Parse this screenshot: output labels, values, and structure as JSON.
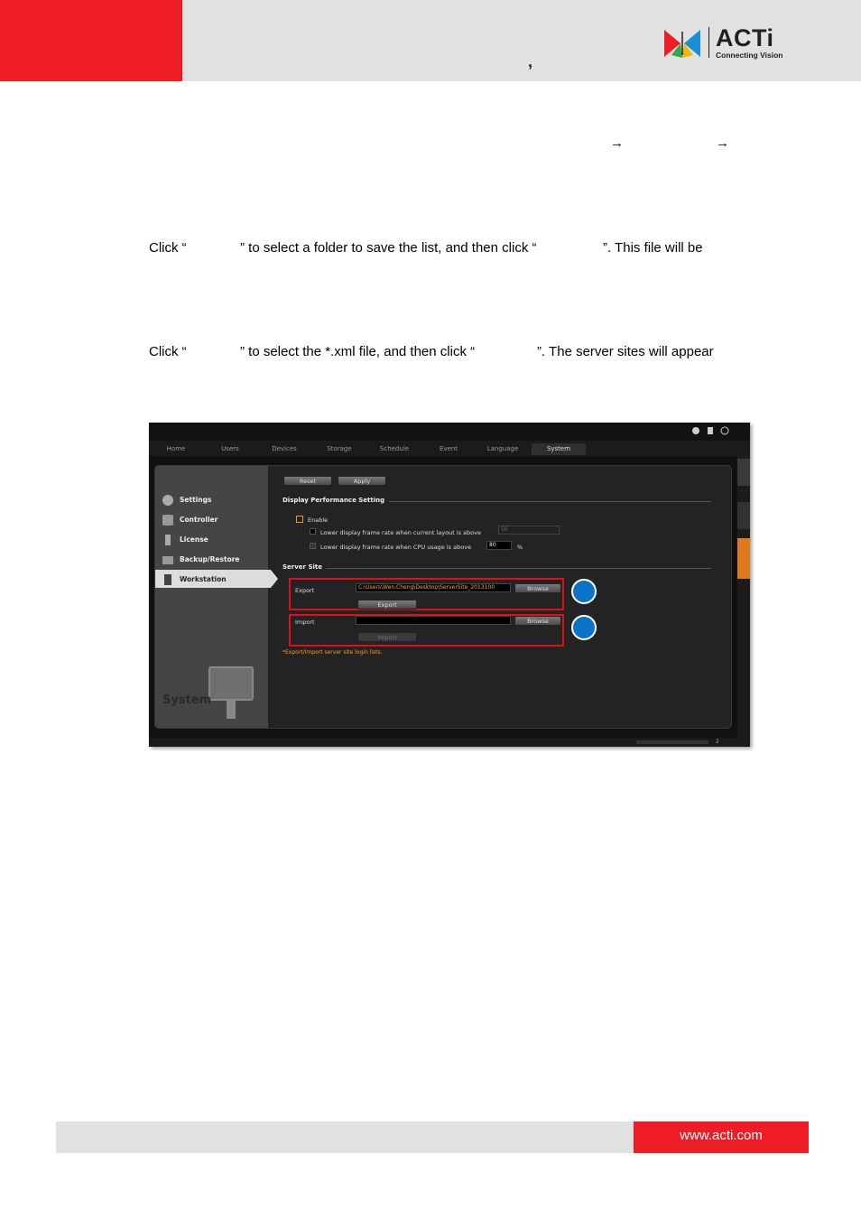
{
  "header": {
    "comma": ",",
    "logo_word": "ACTi",
    "logo_tagline": "Connecting Vision"
  },
  "doc": {
    "arrows": [
      "→",
      "→"
    ],
    "line1_a": "Click “",
    "line1_b": "” to select a folder to save the list, and then click “",
    "line1_c": "”. This file will be",
    "line2_a": "Click “",
    "line2_b": "” to select the *.xml file, and then click “",
    "line2_c": "”. The server sites will appear"
  },
  "app": {
    "tabs": [
      "Home",
      "Users",
      "Devices",
      "Storage",
      "Schedule",
      "Event",
      "Language",
      "System"
    ],
    "active_tab": "System",
    "sidebar": {
      "items": [
        "Settings",
        "Controller",
        "License",
        "Backup/Restore",
        "Workstation"
      ],
      "active": "Workstation",
      "watermark": "System"
    },
    "buttons": {
      "reset": "Reset",
      "apply": "Apply"
    },
    "display_section": "Display Performance Setting",
    "enable_label": "Enable",
    "option1_label": "Lower display frame rate when current layout is above",
    "option1_value": "16",
    "option2_label": "Lower display frame rate when CPU usage is above",
    "option2_value": "80",
    "option2_unit": "%",
    "server_section": "Server Site",
    "export_label": "Export",
    "export_path": "C:\\Users\\Wen.Cheng\\Desktop\\ServerSite_2013100",
    "browse_label": "Browse",
    "export_button": "Export",
    "import_label": "Import",
    "import_path": "",
    "import_button": "Import",
    "note": "*Export/Import server site login lists.",
    "status_count": "2"
  },
  "footer": {
    "url": "www.acti.com"
  },
  "colors": {
    "brand_red": "#ee1c25",
    "callout_blue": "#0a72c8",
    "highlight_red": "#e0101a"
  }
}
